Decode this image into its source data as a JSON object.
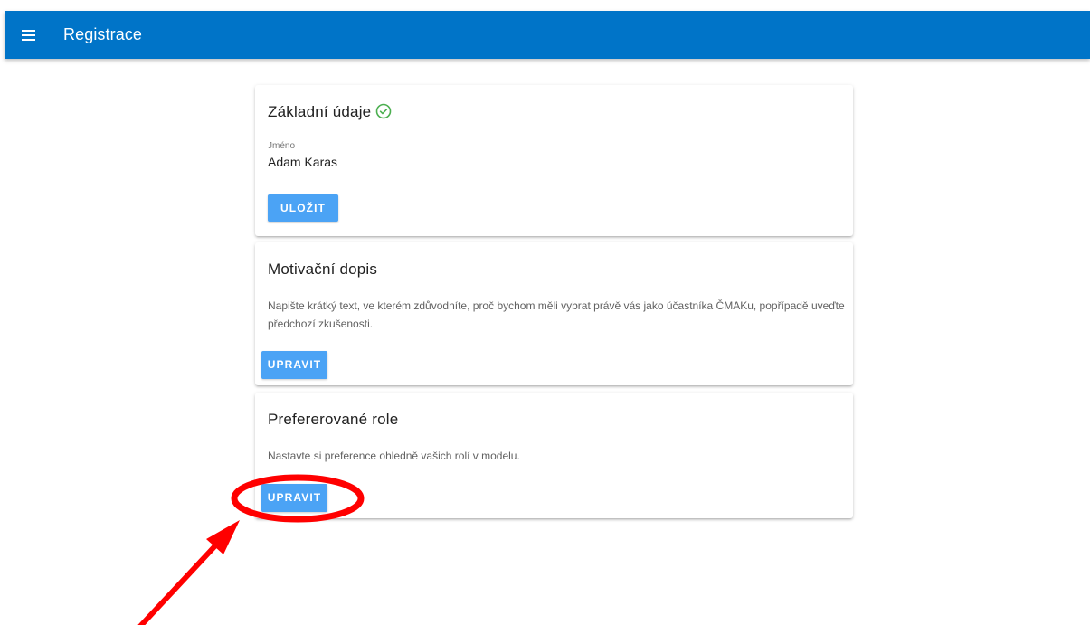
{
  "app_bar": {
    "title": "Registrace",
    "menu_icon": "hamburger-menu-icon",
    "background": "#0074c8"
  },
  "basic_info": {
    "title": "Základní údaje",
    "status_icon": "check-circle-icon",
    "status_color": "#4caf50",
    "name_label": "Jméno",
    "name_value": "Adam Karas",
    "save_label": "ULOŽIT"
  },
  "motivation": {
    "title": "Motivační dopis",
    "description": "Napište krátký text, ve kterém zdůvodníte, proč bychom měli vybrat právě vás jako účastníka ČMAKu, popřípadě uveďte předchozí zkušenosti.",
    "edit_label": "UPRAVIT"
  },
  "roles": {
    "title": "Prefererované role",
    "description": "Nastavte si preference ohledně vašich rolí v modelu.",
    "edit_label": "UPRAVIT"
  },
  "colors": {
    "button": "#4ba3f5",
    "annotation": "#ff0000"
  }
}
